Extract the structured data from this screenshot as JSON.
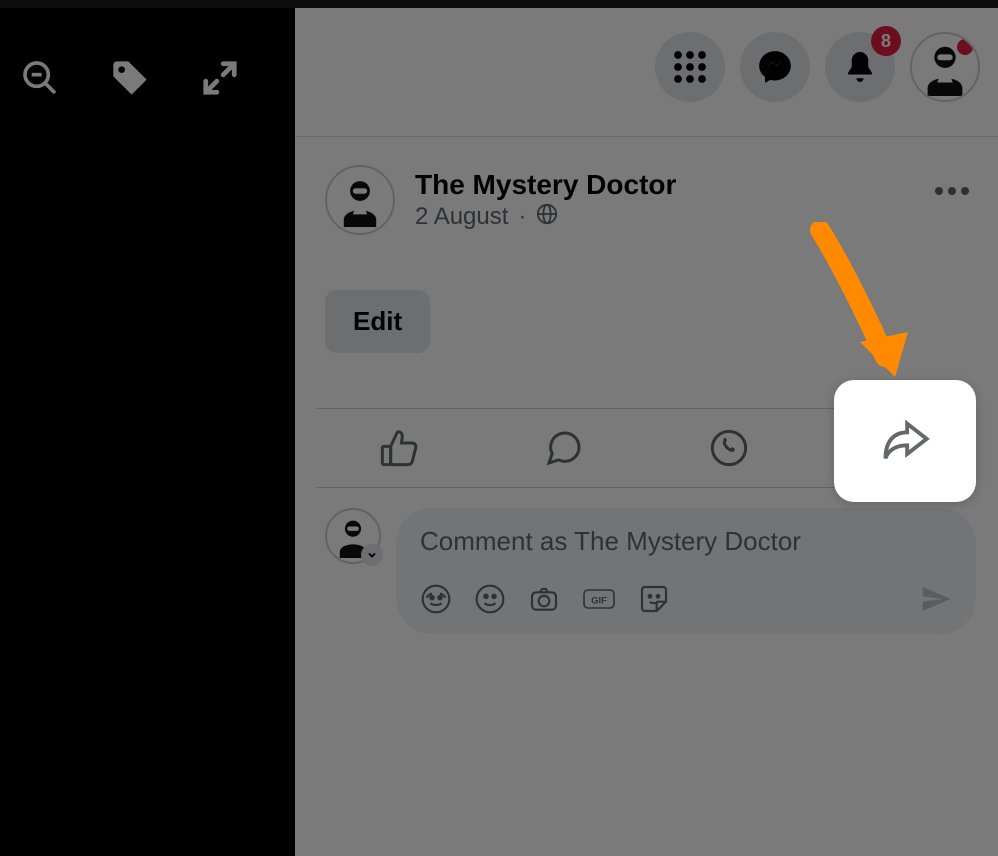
{
  "header": {
    "notification_count": "8"
  },
  "post": {
    "author": "The Mystery Doctor",
    "date": "2 August",
    "edit_label": "Edit"
  },
  "comment": {
    "placeholder": "Comment as The Mystery Doctor"
  },
  "icons": {
    "zoom_out": "zoom-out",
    "tag": "tag",
    "expand": "expand",
    "menu_grid": "menu-grid",
    "messenger": "messenger",
    "bell": "bell",
    "globe": "globe",
    "like": "like",
    "comment_bubble": "comment",
    "whatsapp": "whatsapp",
    "share": "share",
    "avatar_emoji": "avatar-emoji",
    "smile": "smile",
    "camera": "camera",
    "gif": "gif",
    "sticker": "sticker",
    "send": "send"
  }
}
